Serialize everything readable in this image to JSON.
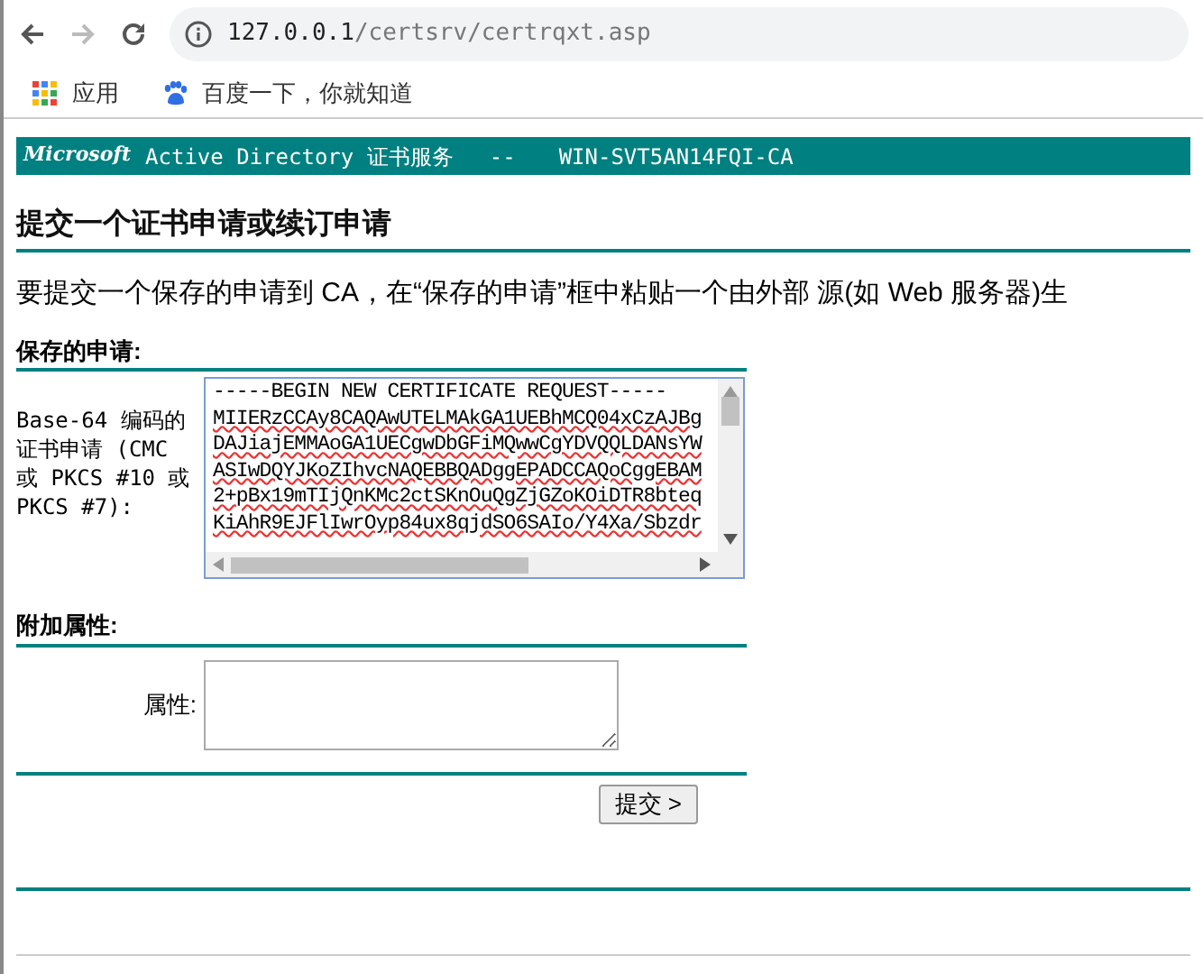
{
  "browser": {
    "url_host": "127.0.0.1",
    "url_path": "/certsrv/certrqxt.asp",
    "bookmarks": [
      {
        "label": "应用",
        "kind": "apps"
      },
      {
        "label": "百度一下，你就知道",
        "kind": "paw"
      }
    ]
  },
  "header": {
    "logo": "Microsoft",
    "title": "Active Directory 证书服务",
    "separator": "--",
    "ca_name": "WIN-SVT5AN14FQI-CA"
  },
  "page_title": "提交一个证书申请或续订申请",
  "intro": "要提交一个保存的申请到 CA，在“保存的申请”框中粘贴一个由外部 源(如 Web 服务器)生",
  "saved_request": {
    "heading": "保存的申请:",
    "label": "Base-64 编码的证书申请 (CMC 或 PKCS #10 或 PKCS #7):",
    "lines": [
      "-----BEGIN NEW CERTIFICATE REQUEST-----",
      "MIIERzCCAy8CAQAwUTELMAkGA1UEBhMCQ04xCzAJBg",
      "DAJiajEMMAoGA1UECgwDbGFiMQwwCgYDVQQLDANsYW",
      "ASIwDQYJKoZIhvcNAQEBBQADggEPADCCAQoCggEBAM",
      "2+pBx19mTIjQnKMc2ctSKnOuQgZjGZoKOiDTR8bteq",
      "KiAhR9EJFlIwrOyp84ux8qjdSO6SAIo/Y4Xa/Sbzdr"
    ]
  },
  "attributes": {
    "heading": "附加属性:",
    "label": "属性:"
  },
  "submit": "提交 >"
}
